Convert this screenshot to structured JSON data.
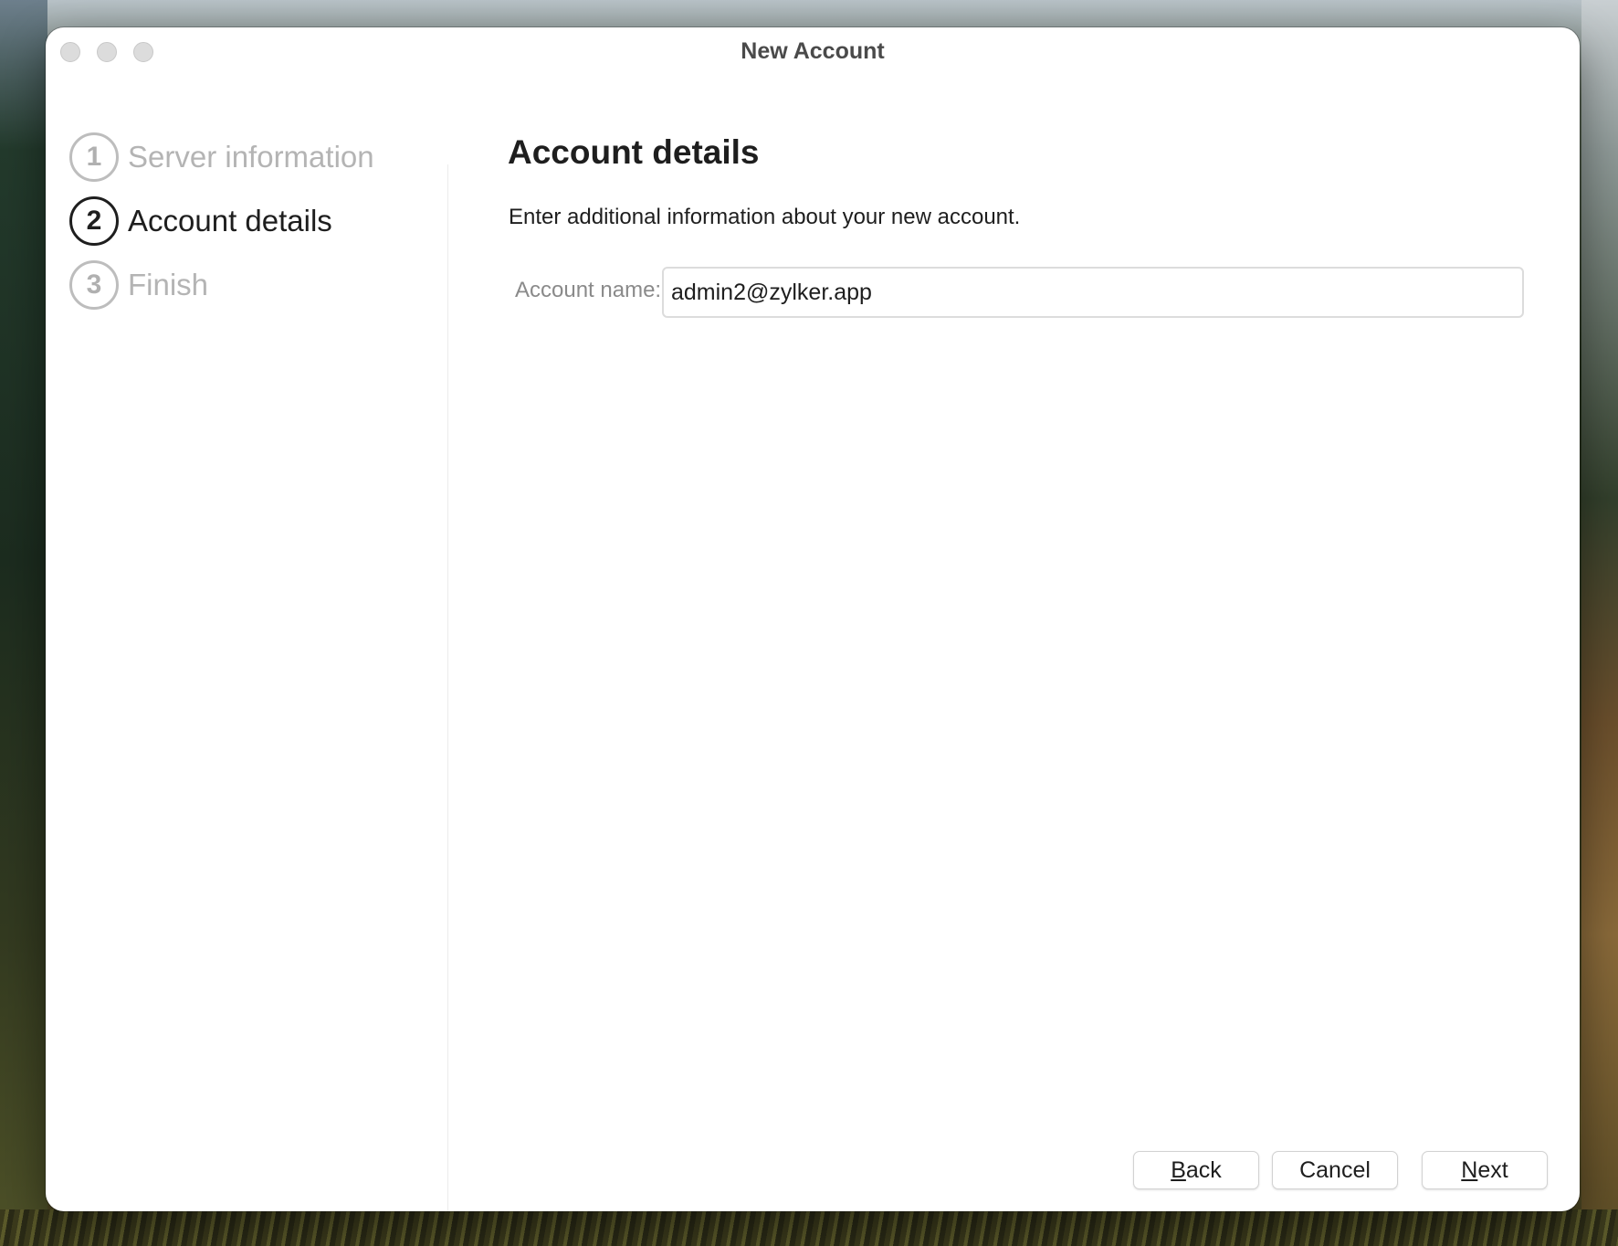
{
  "window": {
    "title": "New Account"
  },
  "steps": [
    {
      "number": "1",
      "label": "Server information",
      "state": "done"
    },
    {
      "number": "2",
      "label": "Account details",
      "state": "active"
    },
    {
      "number": "3",
      "label": "Finish",
      "state": "pending"
    }
  ],
  "page": {
    "heading": "Account details",
    "description": "Enter additional information about your new account.",
    "account_name_label": "Account name:",
    "account_name_value": "admin2@zylker.app"
  },
  "buttons": {
    "back_mnemonic": "B",
    "back_rest": "ack",
    "cancel_label": "Cancel",
    "next_mnemonic": "N",
    "next_rest": "ext"
  },
  "colors": {
    "active_text": "#1e1e1e",
    "inactive_text": "#b4b4b4",
    "label_gray": "#8a8a8a"
  }
}
